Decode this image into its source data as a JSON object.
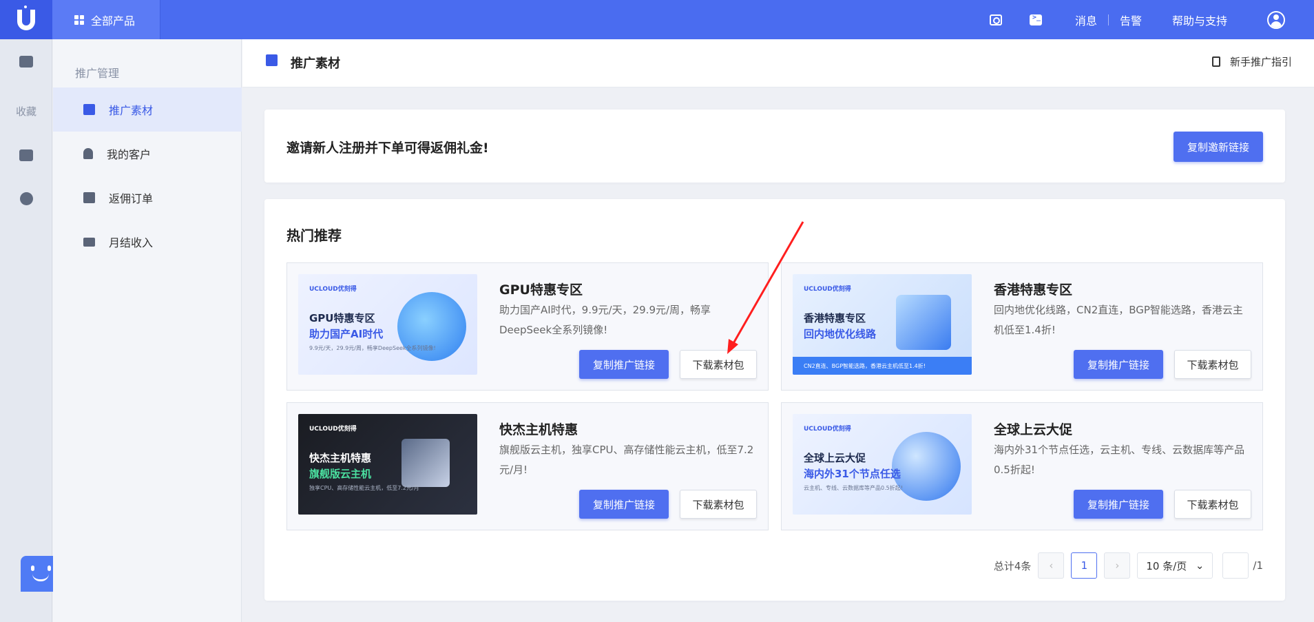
{
  "topbar": {
    "all_products": "全部产品",
    "messages": "消息",
    "alerts": "告警",
    "help": "帮助与支持"
  },
  "rail": {
    "favorites": "收藏"
  },
  "sidebar": {
    "title": "推广管理",
    "items": [
      {
        "label": "推广素材",
        "active": true
      },
      {
        "label": "我的客户"
      },
      {
        "label": "返佣订单"
      },
      {
        "label": "月结收入"
      }
    ]
  },
  "header": {
    "title": "推广素材",
    "guide": "新手推广指引"
  },
  "invite": {
    "text": "邀请新人注册并下单可得返佣礼金!",
    "button": "复制邀新链接"
  },
  "hot": {
    "title": "热门推荐",
    "copy_label": "复制推广链接",
    "download_label": "下载素材包",
    "items": [
      {
        "title": "GPU特惠专区",
        "desc": "助力国产AI时代，9.9元/天，29.9元/周，畅享DeepSeek全系列镜像!",
        "banner": {
          "brand": "UCLOUD优刻得",
          "t1": "GPU特惠专区",
          "t2": "助力国产AI时代",
          "t3": "9.9元/天，29.9元/周，畅享DeepSeek全系列镜像!"
        }
      },
      {
        "title": "香港特惠专区",
        "desc": "回内地优化线路，CN2直连，BGP智能选路，香港云主机低至1.4折!",
        "banner": {
          "brand": "UCLOUD优刻得",
          "t1": "香港特惠专区",
          "t2": "回内地优化线路",
          "t3": "CN2直连、BGP智能选路，香港云主机低至1.4折!"
        }
      },
      {
        "title": "快杰主机特惠",
        "desc": "旗舰版云主机，独享CPU、高存储性能云主机，低至7.2元/月!",
        "banner": {
          "brand": "UCLOUD优刻得",
          "t1": "快杰主机特惠",
          "t2": "旗舰版云主机",
          "t3": "独享CPU、高存储性能云主机，低至7.2元/月"
        }
      },
      {
        "title": "全球上云大促",
        "desc": "海内外31个节点任选，云主机、专线、云数据库等产品0.5折起!",
        "banner": {
          "brand": "UCLOUD优刻得",
          "t1": "全球上云大促",
          "t2": "海内外31个节点任选",
          "t3": "云主机、专线、云数据库等产品0.5折起!"
        }
      }
    ]
  },
  "pager": {
    "total": "总计4条",
    "prev": "‹",
    "current": "1",
    "next": "›",
    "size": "10 条/页",
    "chevron": "⌄",
    "pages": "/1"
  },
  "colors": {
    "primary": "#4f6ff0",
    "topbar": "#4a6cf0",
    "arrow": "#ff1f1f"
  }
}
